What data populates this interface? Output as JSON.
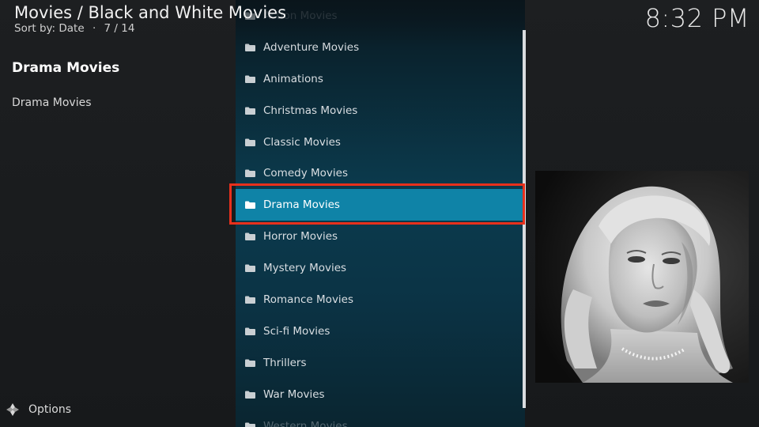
{
  "header": {
    "breadcrumb": "Movies / Black and White Movies",
    "sort_label": "Sort by: Date",
    "position": "7 / 14",
    "separator": "·",
    "clock": "8:32 PM"
  },
  "info": {
    "title": "Drama Movies",
    "label": "Drama Movies"
  },
  "list": {
    "items": [
      "Action Movies",
      "Adventure Movies",
      "Animations",
      "Christmas Movies",
      "Classic Movies",
      "Comedy Movies",
      "Drama Movies",
      "Horror Movies",
      "Mystery Movies",
      "Romance Movies",
      "Sci-fi Movies",
      "Thrillers",
      "War Movies",
      "Western Movies"
    ],
    "selected_index": 6
  },
  "footer": {
    "options_label": "Options",
    "options_icon": "options-icon"
  },
  "poster": {
    "icon": "poster-image"
  },
  "colors": {
    "selection_bg": "#0f83a7",
    "highlight_frame": "#e8301c"
  }
}
